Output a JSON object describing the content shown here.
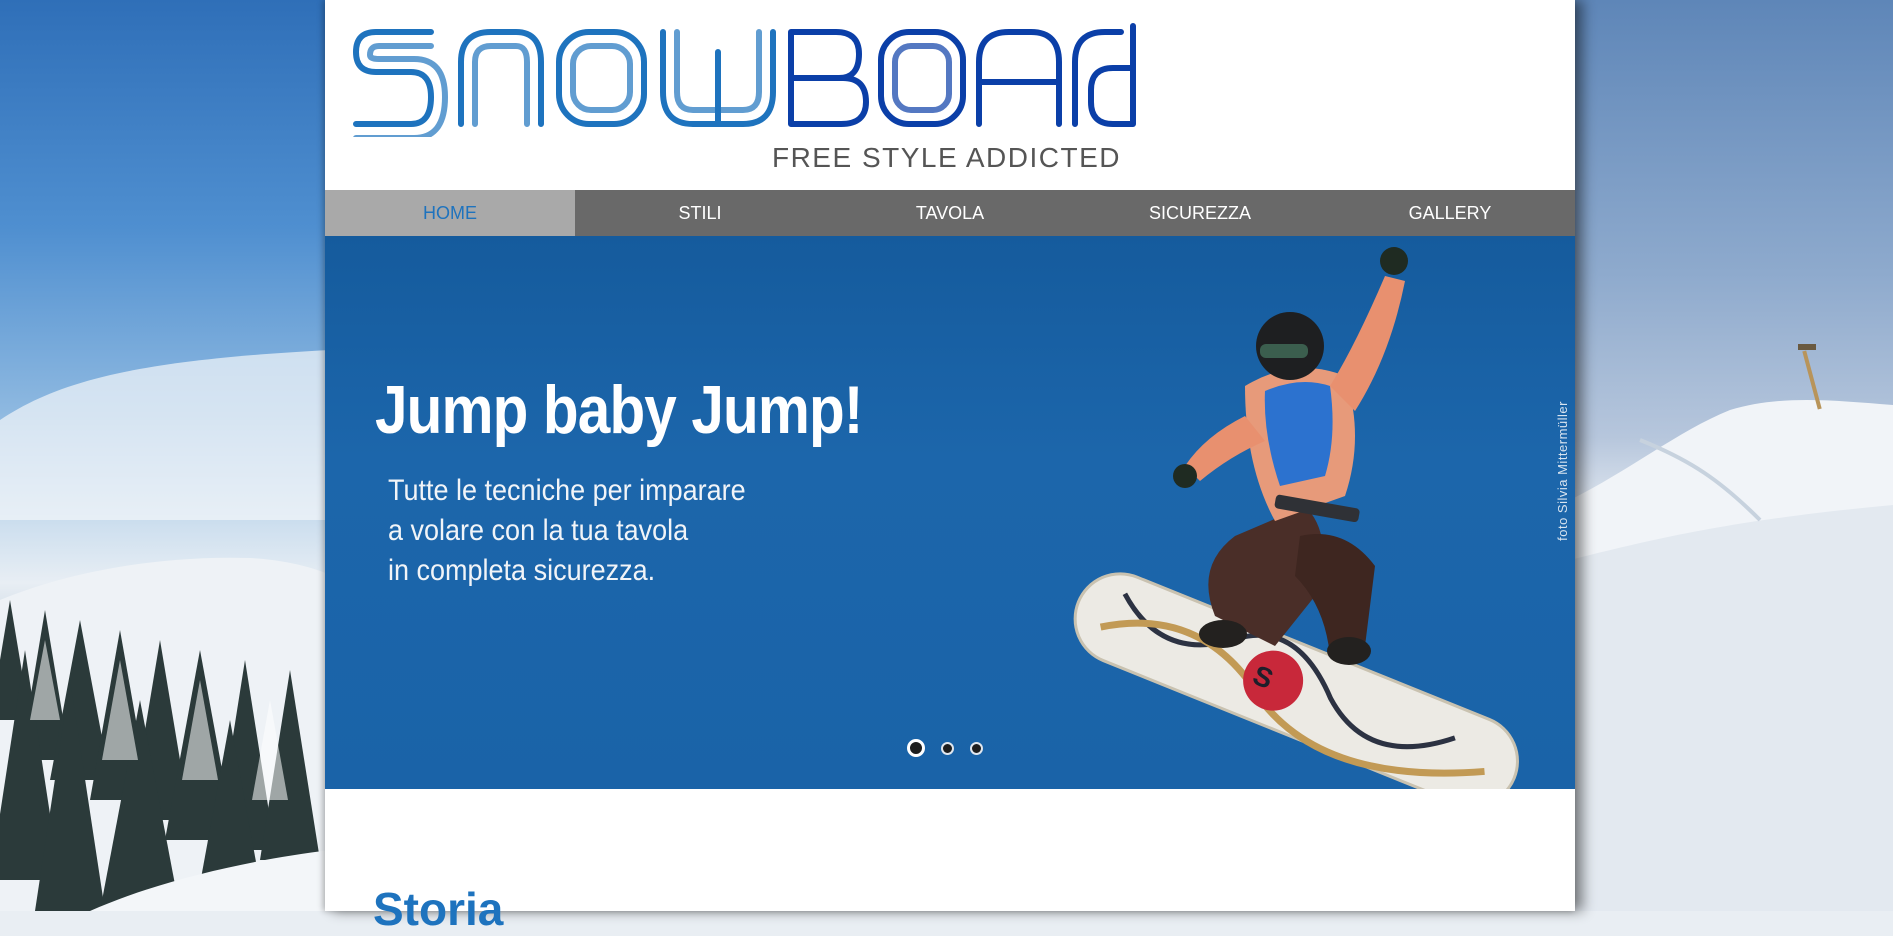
{
  "logo": {
    "brand": "SNOWBOARD",
    "tagline": "FREE STYLE ADDICTED",
    "colors": {
      "primary": "#1e73be",
      "secondary": "#0b3fa8"
    }
  },
  "nav": {
    "items": [
      {
        "label": "HOME",
        "active": true
      },
      {
        "label": "STILI"
      },
      {
        "label": "TAVOLA"
      },
      {
        "label": "SICUREZZA"
      },
      {
        "label": "GALLERY"
      }
    ]
  },
  "hero": {
    "title": "Jump baby Jump!",
    "subtitle_lines": [
      "Tutte le tecniche per imparare",
      "a volare con la tua tavola",
      "in completa sicurezza."
    ],
    "photo_credit": "foto Silvia Mittermüller",
    "slides_total": 3,
    "active_slide": 1,
    "background_color": "#1a63a8"
  },
  "main": {
    "section_title": "Storia"
  }
}
